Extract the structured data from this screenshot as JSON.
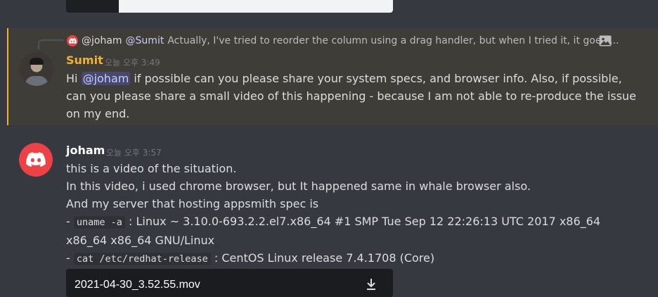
{
  "reply": {
    "author": "@joham",
    "mention": "@Sumit",
    "text": "Actually, I've tried to reorder the column using a drag handler, but when I tried it, it goes ..."
  },
  "message1": {
    "username": "Sumit",
    "timestamp": "오늘 오후 3:49",
    "username_color": "#f0b232",
    "line1_pre": "Hi ",
    "line1_mention": "@joham",
    "line1_post": " if possible can you please share your system specs, and browser info. Also, if possible,",
    "line2": "can you please share a small video of this happening - because I am not able to re-produce the issue",
    "line3": "on my end."
  },
  "message2": {
    "username": "joham",
    "timestamp": "오늘 오후 3:57",
    "lines": [
      "this is a video of the situation.",
      "In this video, i used chrome browser, but It happened same in whale browser also.",
      "And my server that hosting appsmith spec is"
    ],
    "spec1_prefix": "- ",
    "spec1_code": "uname -a",
    "spec1_text": " : Linux ~ 3.10.0-693.2.2.el7.x86_64 #1 SMP Tue Sep 12 22:26:13 UTC 2017 x86_64",
    "spec1_cont": "x86_64 x86_64 GNU/Linux",
    "spec2_prefix": "- ",
    "spec2_code": "cat /etc/redhat-release",
    "spec2_text": " : CentOS Linux release 7.4.1708 (Core)",
    "attachment": "2021-04-30_3.52.55.mov"
  },
  "colors": {
    "background": "#36393f",
    "highlight": "#3f3d38",
    "highlight_border": "#f0b232",
    "mention": "#c9cdfb",
    "discord_red": "#ed4245"
  },
  "icons": [
    "discord-logo-icon",
    "image-icon",
    "download-icon"
  ]
}
